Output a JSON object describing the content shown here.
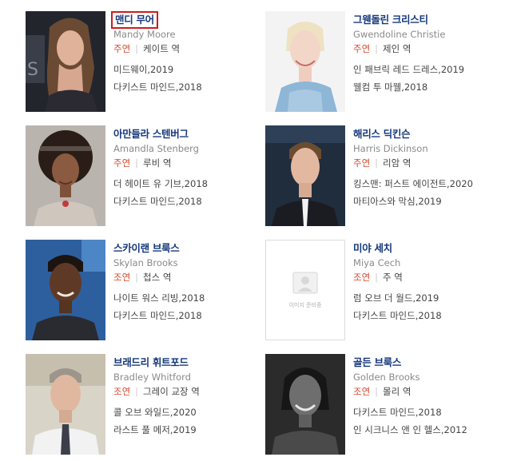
{
  "cast": [
    {
      "name_ko": "맨디 무어",
      "name_en": "Mandy Moore",
      "role_type": "주연",
      "character": "케이트 역",
      "works": [
        "미드웨이,2019",
        "다키스트 마인드,2018"
      ]
    },
    {
      "name_ko": "그웬돌린 크리스티",
      "name_en": "Gwendoline Christie",
      "role_type": "주연",
      "character": "제인 역",
      "works": [
        "인 패브릭 레드 드레스,2019",
        "웰컴 투 마웰,2018"
      ]
    },
    {
      "name_ko": "아만들라 스텐버그",
      "name_en": "Amandla Stenberg",
      "role_type": "주연",
      "character": "루비 역",
      "works": [
        "더 헤이트 유 기브,2018",
        "다키스트 마인드,2018"
      ]
    },
    {
      "name_ko": "해리스 딕킨슨",
      "name_en": "Harris Dickinson",
      "role_type": "주연",
      "character": "리암 역",
      "works": [
        "킹스맨: 퍼스트 에이전트,2020",
        "마티아스와 막심,2019"
      ]
    },
    {
      "name_ko": "스카이랜 브룩스",
      "name_en": "Skylan Brooks",
      "role_type": "조연",
      "character": "첩스 역",
      "works": [
        "나이트 워스 리빙,2018",
        "다키스트 마인드,2018"
      ]
    },
    {
      "name_ko": "미야 세치",
      "name_en": "Miya Cech",
      "role_type": "조연",
      "character": "주 역",
      "works": [
        "럼 오브 더 월드,2019",
        "다키스트 마인드,2018"
      ]
    },
    {
      "name_ko": "브래드리 휘트포드",
      "name_en": "Bradley Whitford",
      "role_type": "조연",
      "character": "그레이 교장 역",
      "works": [
        "콜 오브 와일드,2020",
        "라스트 풀 메저,2019"
      ]
    },
    {
      "name_ko": "골든 브룩스",
      "name_en": "Golden Brooks",
      "role_type": "조연",
      "character": "몰리 역",
      "works": [
        "다키스트 마인드,2018",
        "인 시크니스 앤 인 헬스,2012"
      ]
    }
  ],
  "no_image_label": "이미지 준비중"
}
